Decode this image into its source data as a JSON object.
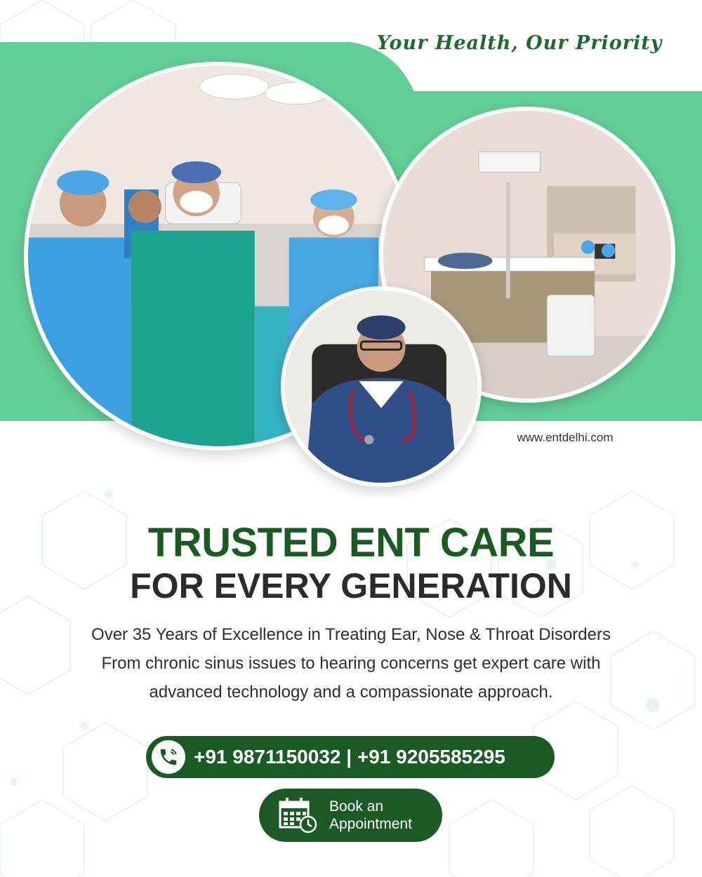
{
  "brand": {
    "tagline": "Your Health, Our Priority",
    "website": "www.entdelhi.com",
    "colors": {
      "primary_green": "#1c5a25",
      "light_green": "#63cf98",
      "headline_green": "#1a5b24",
      "text_dark": "#2b2b2b"
    }
  },
  "images": {
    "surgery_team": "surgical-team-photo",
    "patient_room": "patient-room-photo",
    "doctor_portrait": "doctor-portrait-photo"
  },
  "hero": {
    "headline": "TRUSTED ENT CARE",
    "subheadline": "FOR EVERY GENERATION",
    "description_lines": [
      "Over 35 Years of Excellence in Treating Ear, Nose & Throat Disorders",
      "From chronic sinus issues to hearing concerns get expert care with",
      "advanced technology and a compassionate approach."
    ]
  },
  "contact": {
    "phone_icon": "phone-icon",
    "phones": "+91 9871150032 | +91 9205585295"
  },
  "cta": {
    "icon": "calendar-clock-icon",
    "line1": "Book an",
    "line2": "Appointment"
  }
}
